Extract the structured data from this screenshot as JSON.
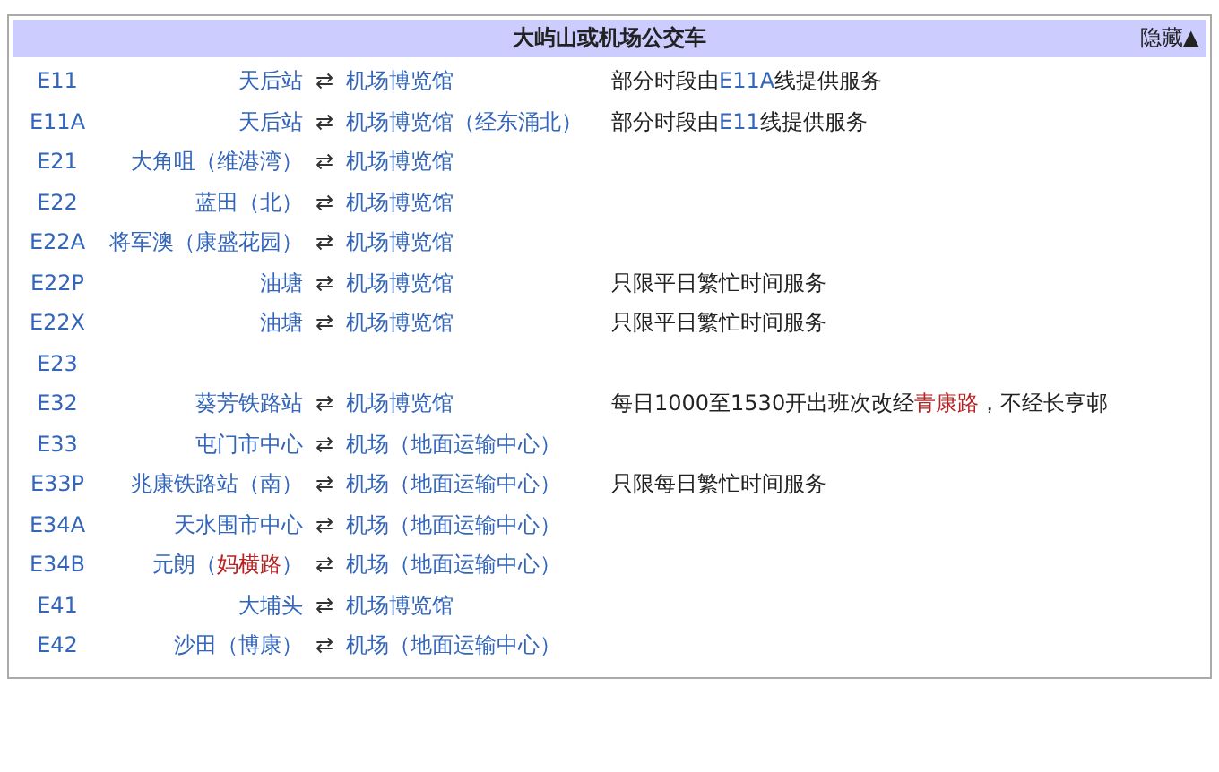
{
  "navbox": {
    "title": "大屿山或机场公交车",
    "toggle": "隐藏▲",
    "rows": [
      {
        "code": "E11",
        "origin": [
          {
            "text": "天后站",
            "kind": "link"
          }
        ],
        "arrow": "⇄",
        "destination": [
          {
            "text": "机场博览馆",
            "kind": "link"
          }
        ],
        "note": [
          {
            "text": "部分时段由",
            "kind": "plain"
          },
          {
            "text": "E11A",
            "kind": "link"
          },
          {
            "text": "线提供服务",
            "kind": "plain"
          }
        ]
      },
      {
        "code": "E11A",
        "origin": [
          {
            "text": "天后站",
            "kind": "link"
          }
        ],
        "arrow": "⇄",
        "destination": [
          {
            "text": "机场博览馆（经东涌北）",
            "kind": "link"
          }
        ],
        "note": [
          {
            "text": "部分时段由",
            "kind": "plain"
          },
          {
            "text": "E11",
            "kind": "link"
          },
          {
            "text": "线提供服务",
            "kind": "plain"
          }
        ]
      },
      {
        "code": "E21",
        "origin": [
          {
            "text": "大角咀（维港湾）",
            "kind": "link"
          }
        ],
        "arrow": "⇄",
        "destination": [
          {
            "text": "机场博览馆",
            "kind": "link"
          }
        ]
      },
      {
        "code": "E22",
        "origin": [
          {
            "text": "蓝田（北）",
            "kind": "link"
          }
        ],
        "arrow": "⇄",
        "destination": [
          {
            "text": "机场博览馆",
            "kind": "link"
          }
        ]
      },
      {
        "code": "E22A",
        "origin": [
          {
            "text": "将军澳（康盛花园）",
            "kind": "link"
          }
        ],
        "arrow": "⇄",
        "destination": [
          {
            "text": "机场博览馆",
            "kind": "link"
          }
        ]
      },
      {
        "code": "E22P",
        "origin": [
          {
            "text": "油塘",
            "kind": "link"
          }
        ],
        "arrow": "⇄",
        "destination": [
          {
            "text": "机场博览馆",
            "kind": "link"
          }
        ],
        "note": [
          {
            "text": "只限平日繁忙时间服务",
            "kind": "plain"
          }
        ]
      },
      {
        "code": "E22X",
        "origin": [
          {
            "text": "油塘",
            "kind": "link"
          }
        ],
        "arrow": "⇄",
        "destination": [
          {
            "text": "机场博览馆",
            "kind": "link"
          }
        ],
        "note": [
          {
            "text": "只限平日繁忙时间服务",
            "kind": "plain"
          }
        ]
      },
      {
        "code": "E23"
      },
      {
        "code": "E32",
        "origin": [
          {
            "text": "葵芳铁路站",
            "kind": "link"
          }
        ],
        "arrow": "⇄",
        "destination": [
          {
            "text": "机场博览馆",
            "kind": "link"
          }
        ],
        "note": [
          {
            "text": "每日1000至1530开出班次改经",
            "kind": "plain"
          },
          {
            "text": "青康路",
            "kind": "redlink"
          },
          {
            "text": "，不经长亨邨",
            "kind": "plain"
          }
        ]
      },
      {
        "code": "E33",
        "origin": [
          {
            "text": "屯门市中心",
            "kind": "link"
          }
        ],
        "arrow": "⇄",
        "destination": [
          {
            "text": "机场（地面运输中心）",
            "kind": "link"
          }
        ]
      },
      {
        "code": "E33P",
        "origin": [
          {
            "text": "兆康铁路站（南）",
            "kind": "link"
          }
        ],
        "arrow": "⇄",
        "destination": [
          {
            "text": "机场（地面运输中心）",
            "kind": "link"
          }
        ],
        "note": [
          {
            "text": "只限每日繁忙时间服务",
            "kind": "plain"
          }
        ]
      },
      {
        "code": "E34A",
        "origin": [
          {
            "text": "天水围市中心",
            "kind": "link"
          }
        ],
        "arrow": "⇄",
        "destination": [
          {
            "text": "机场（地面运输中心）",
            "kind": "link"
          }
        ]
      },
      {
        "code": "E34B",
        "origin": [
          {
            "text": "元朗（",
            "kind": "link"
          },
          {
            "text": "妈横路",
            "kind": "redlink"
          },
          {
            "text": "）",
            "kind": "link"
          }
        ],
        "arrow": "⇄",
        "destination": [
          {
            "text": "机场（地面运输中心）",
            "kind": "link"
          }
        ]
      },
      {
        "code": "E41",
        "origin": [
          {
            "text": "大埔头",
            "kind": "link"
          }
        ],
        "arrow": "⇄",
        "destination": [
          {
            "text": "机场博览馆",
            "kind": "link"
          }
        ]
      },
      {
        "code": "E42",
        "origin": [
          {
            "text": "沙田（博康）",
            "kind": "link"
          }
        ],
        "arrow": "⇄",
        "destination": [
          {
            "text": "机场（地面运输中心）",
            "kind": "link"
          }
        ]
      }
    ]
  }
}
